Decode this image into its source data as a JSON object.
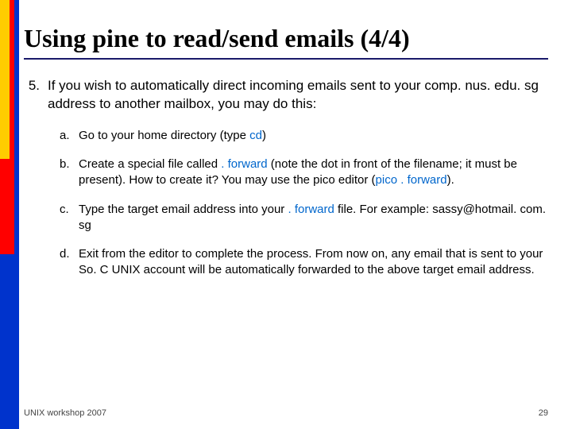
{
  "title": "Using pine to read/send emails (4/4)",
  "mainNumber": "5.",
  "mainText": "If you wish to automatically direct incoming emails sent to your comp. nus. edu. sg address to another mailbox, you may do this:",
  "subs": {
    "a": {
      "letter": "a.",
      "pre": "Go to your home directory (type ",
      "cmd": "cd",
      "post": ")"
    },
    "b": {
      "letter": "b.",
      "pre": "Create a special file called ",
      "cmd1": ". forward",
      "mid": " (note the dot in front of the filename; it must be present). How to create it? You may use the pico editor (",
      "cmd2": "pico . forward",
      "post": ")."
    },
    "c": {
      "letter": "c.",
      "pre": "Type the target email address into your ",
      "cmd": ". forward",
      "post": " file. For example: sassy@hotmail. com. sg"
    },
    "d": {
      "letter": "d.",
      "text": "Exit from the editor to complete the process. From now on, any email that is sent to your So. C UNIX account will be automatically forwarded to the above target email address."
    }
  },
  "footerLeft": "UNIX workshop 2007",
  "footerRight": "29"
}
